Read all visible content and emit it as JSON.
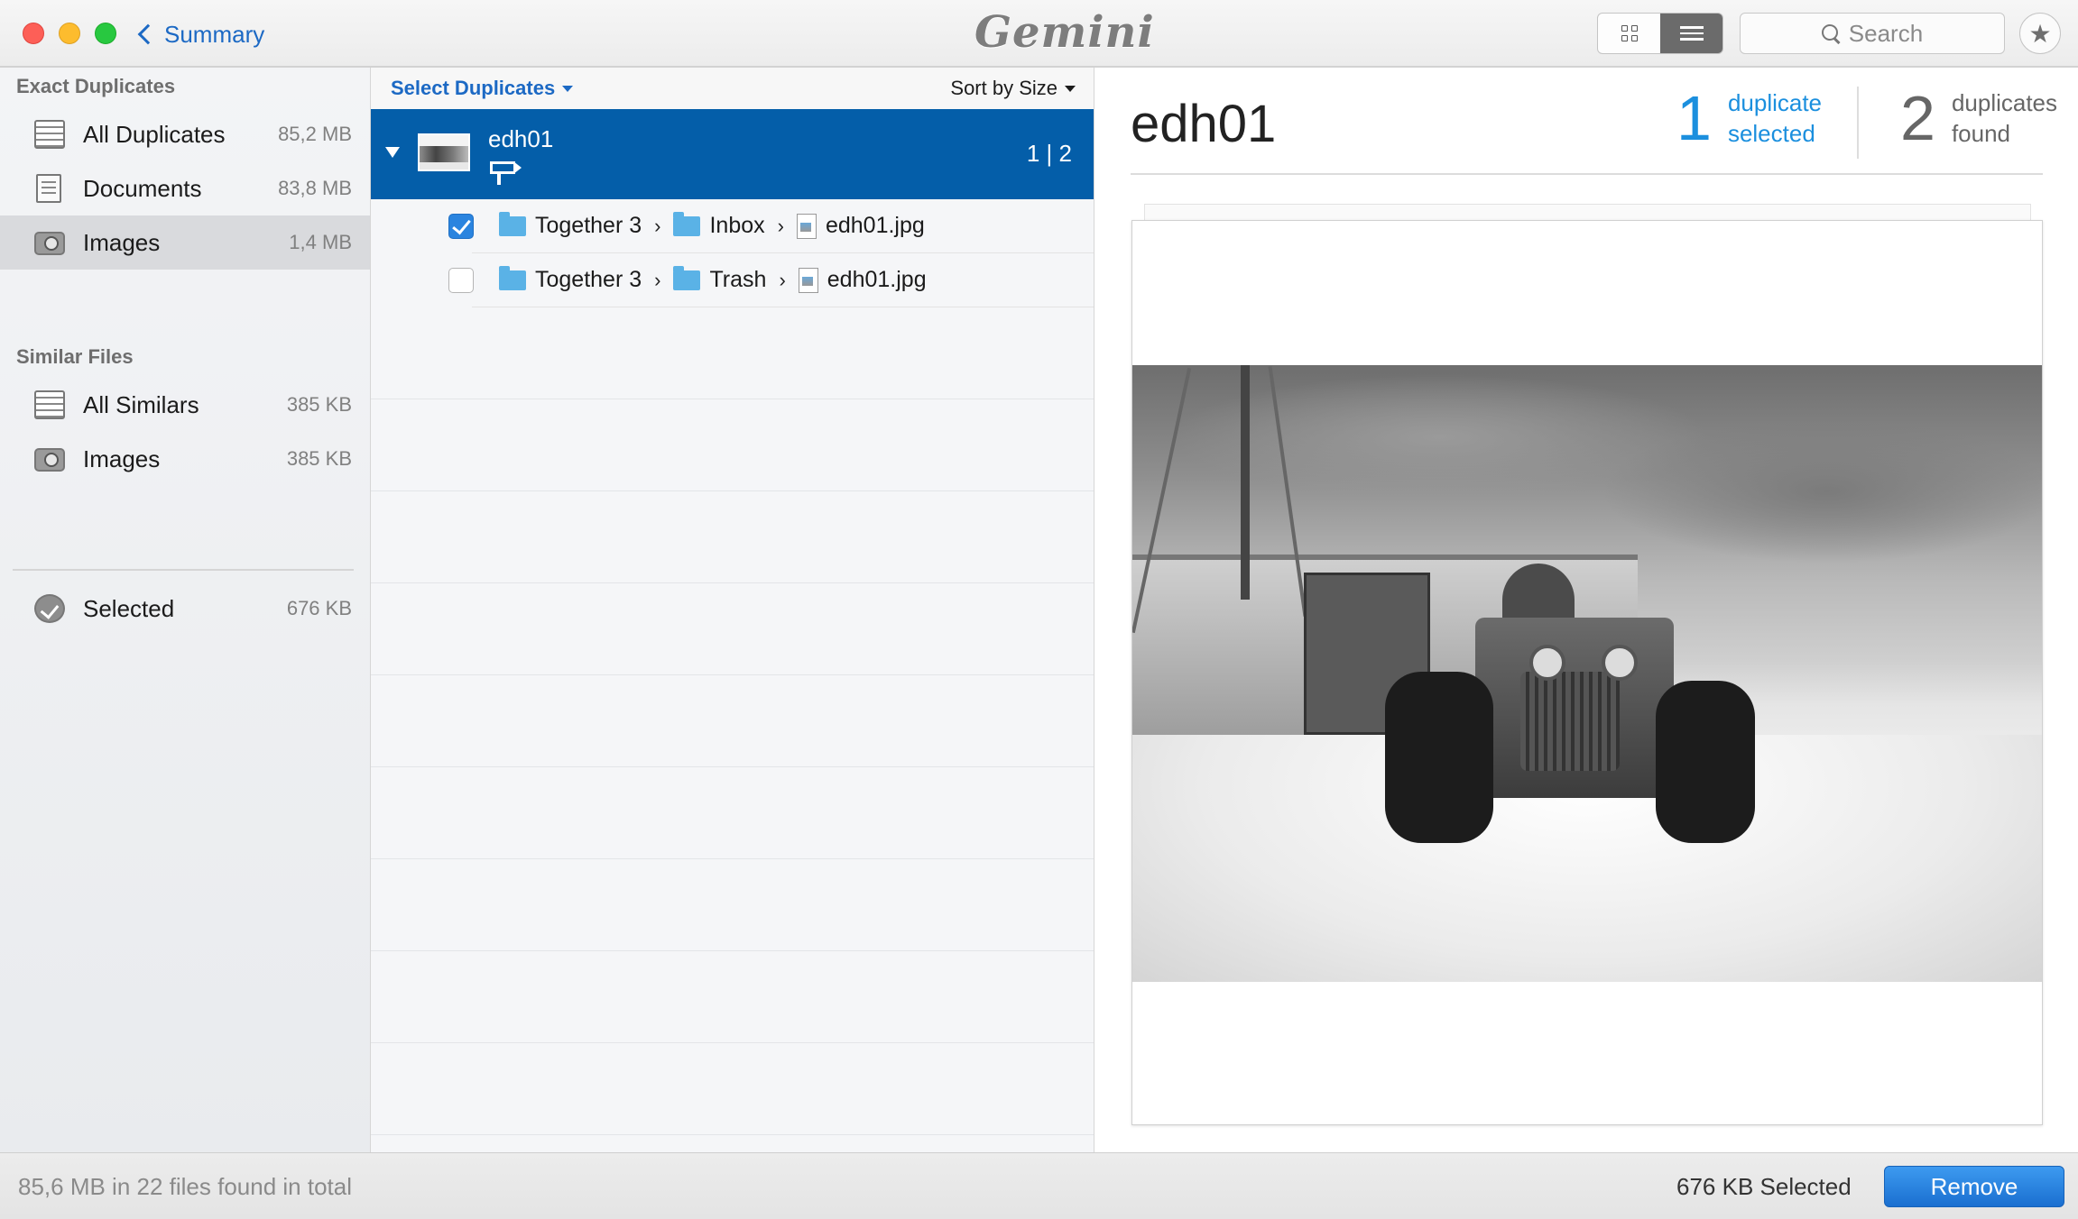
{
  "window": {
    "back_label": "Summary",
    "logo_text": "Gemini",
    "search_placeholder": "Search"
  },
  "sidebar": {
    "exact_header": "Exact Duplicates",
    "exact_items": [
      {
        "label": "All Duplicates",
        "size": "85,2 MB",
        "icon": "stack-icon",
        "selected": false
      },
      {
        "label": "Documents",
        "size": "83,8 MB",
        "icon": "document-icon",
        "selected": false
      },
      {
        "label": "Images",
        "size": "1,4 MB",
        "icon": "camera-icon",
        "selected": true
      }
    ],
    "similar_header": "Similar Files",
    "similar_items": [
      {
        "label": "All Similars",
        "size": "385 KB",
        "icon": "stack-icon"
      },
      {
        "label": "Images",
        "size": "385 KB",
        "icon": "camera-icon"
      }
    ],
    "selected_item": {
      "label": "Selected",
      "size": "676 KB",
      "icon": "checkmark-circle-icon"
    }
  },
  "list": {
    "select_label": "Select Duplicates",
    "sort_label": "Sort by Size",
    "group": {
      "name": "edh01",
      "count": "1 | 2"
    },
    "files": [
      {
        "checked": true,
        "path": [
          "Together 3",
          "Inbox"
        ],
        "file": "edh01.jpg"
      },
      {
        "checked": false,
        "path": [
          "Together 3",
          "Trash"
        ],
        "file": "edh01.jpg"
      }
    ]
  },
  "preview": {
    "title": "edh01",
    "selected_num": "1",
    "selected_label_1": "duplicate",
    "selected_label_2": "selected",
    "found_num": "2",
    "found_label_1": "duplicates",
    "found_label_2": "found"
  },
  "footer": {
    "total": "85,6 MB in 22 files found in total",
    "selected": "676 KB Selected",
    "remove_label": "Remove"
  },
  "colors": {
    "accent": "#1c69c4",
    "selection": "#045ea9",
    "stat_blue": "#1b8fde",
    "remove_button": "#2a84df"
  }
}
